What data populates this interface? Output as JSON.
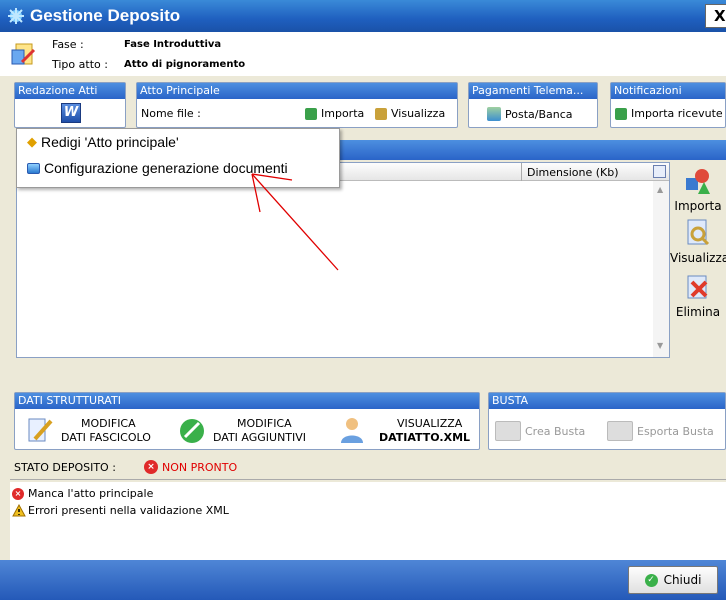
{
  "window": {
    "title": "Gestione Deposito",
    "close_glyph": "X"
  },
  "info": {
    "fase_label": "Fase :",
    "fase_value": "Fase Introduttiva",
    "tipo_label": "Tipo atto :",
    "tipo_value": "Atto di pignoramento"
  },
  "groups": {
    "redazione": {
      "title": "Redazione Atti"
    },
    "atto": {
      "title": "Atto Principale",
      "nome_file_label": "Nome file :",
      "importa": "Importa",
      "visualizza": "Visualizza"
    },
    "pagamenti": {
      "title": "Pagamenti Telema...",
      "posta": "Posta/Banca"
    },
    "notifiche": {
      "title": "Notificazioni",
      "importa_ricevute": "Importa ricevute"
    }
  },
  "context_menu": {
    "items": [
      {
        "label": "Redigi 'Atto principale'",
        "icon": "star-icon"
      },
      {
        "label": "Configurazione generazione documenti",
        "icon": "config-icon"
      }
    ]
  },
  "table": {
    "columns": [
      "Dimensione (Kb)"
    ]
  },
  "side_buttons": {
    "importa": "Importa",
    "visualizza": "Visualizza",
    "elimina": "Elimina"
  },
  "dati": {
    "title": "DATI STRUTTURATI",
    "mod_fasc_1": "MODIFICA",
    "mod_fasc_2": "DATI FASCICOLO",
    "mod_agg_1": "MODIFICA",
    "mod_agg_2": "DATI AGGIUNTIVI",
    "vis_1": "VISUALIZZA",
    "vis_2": "DATIATTO.XML"
  },
  "busta": {
    "title": "BUSTA",
    "crea": "Crea Busta",
    "esporta": "Esporta Busta"
  },
  "stato": {
    "label": "STATO DEPOSITO :",
    "value": "NON PRONTO",
    "value_color": "#e00000"
  },
  "messages": [
    {
      "text": "Manca l'atto principale",
      "icon": "error-icon"
    },
    {
      "text": "Errori presenti nella validazione XML",
      "icon": "warning-icon"
    }
  ],
  "footer": {
    "chiudi": "Chiudi"
  },
  "colors": {
    "accent": "#2a64c8",
    "arrow": "#e00000"
  }
}
